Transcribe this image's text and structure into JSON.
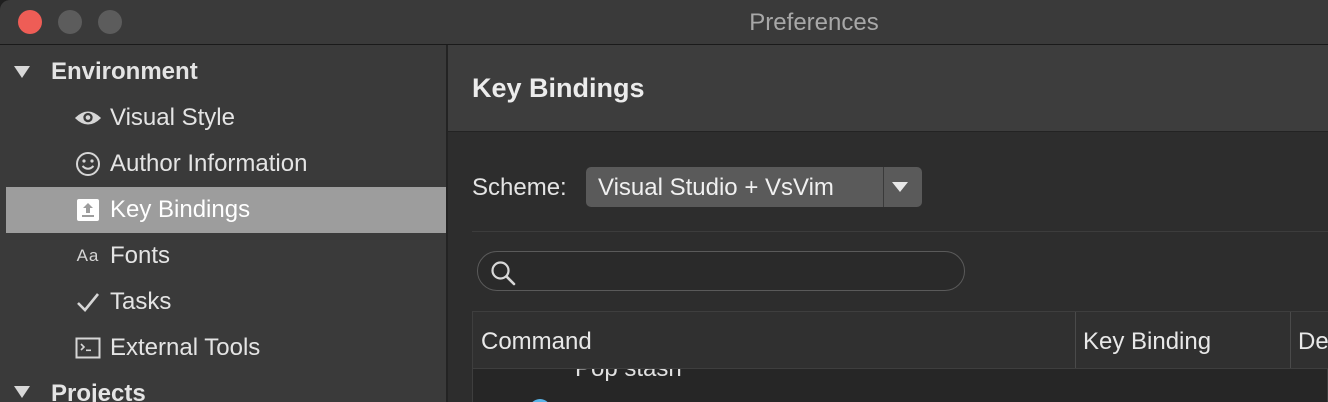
{
  "window": {
    "title": "Preferences"
  },
  "sidebar": {
    "sections": [
      {
        "label": "Environment"
      },
      {
        "label": "Projects"
      }
    ],
    "items": [
      {
        "label": "Visual Style",
        "icon": "eye-icon"
      },
      {
        "label": "Author Information",
        "icon": "smiley-icon"
      },
      {
        "label": "Key Bindings",
        "icon": "key-bindings-icon",
        "selected": true
      },
      {
        "label": "Fonts",
        "icon": "fonts-icon"
      },
      {
        "label": "Tasks",
        "icon": "checkmark-icon"
      },
      {
        "label": "External Tools",
        "icon": "terminal-icon"
      }
    ],
    "fonts_icon_text": "Aa"
  },
  "main": {
    "title": "Key Bindings",
    "scheme": {
      "label": "Scheme:",
      "value": "Visual Studio + VsVim"
    },
    "search": {
      "placeholder": ""
    },
    "table": {
      "columns": [
        "Command",
        "Key Binding",
        "De"
      ],
      "rows": [
        {
          "command": "Pop stash"
        }
      ]
    }
  },
  "colors": {
    "close_button": "#ee5d56",
    "selection": "#9d9d9d",
    "status_dot": "#5ab4e8"
  }
}
